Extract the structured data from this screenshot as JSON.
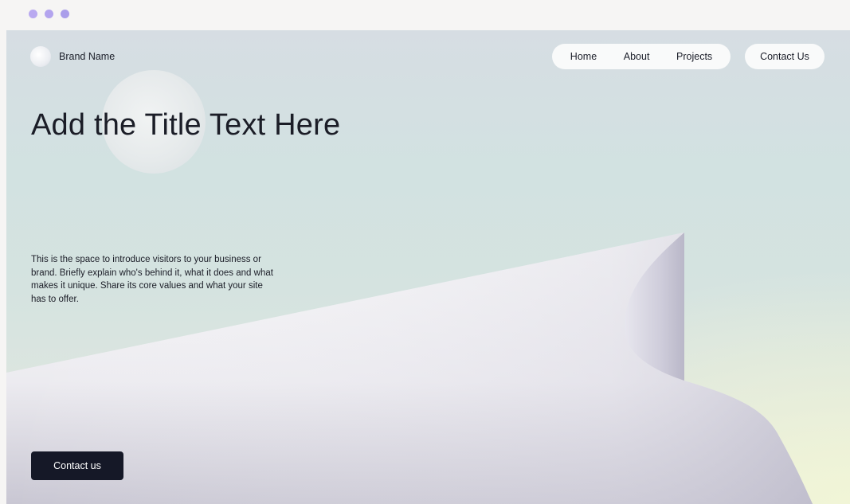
{
  "window": {
    "dot_colors": [
      "#b9a9f0",
      "#b3a4ee",
      "#aa9eea"
    ]
  },
  "header": {
    "brand_name": "Brand Name",
    "nav": [
      {
        "label": "Home"
      },
      {
        "label": "About"
      },
      {
        "label": "Projects"
      }
    ],
    "contact_label": "Contact Us"
  },
  "hero": {
    "title": "Add the Title Text Here",
    "intro": "This is the space to introduce visitors to your business or brand. Briefly explain who's behind it, what it does and what makes it unique. Share its core values and what your site has to offer.",
    "cta_label": "Contact us"
  },
  "colors": {
    "cta_background": "#151827",
    "text": "#1b1d27"
  }
}
